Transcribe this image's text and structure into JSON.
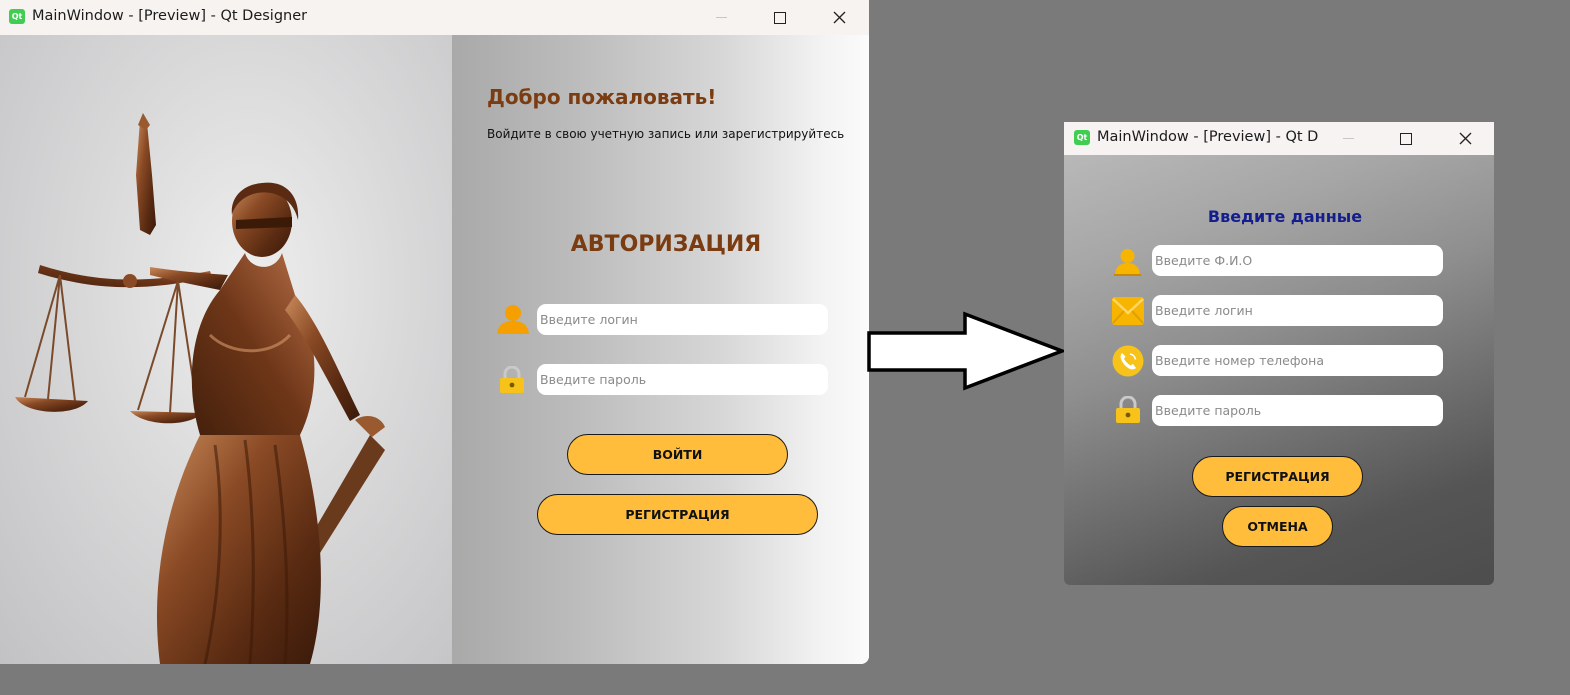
{
  "main_window": {
    "title": "MainWindow - [Preview] - Qt Designer",
    "logo_text": "Qt",
    "welcome_title": "Добро пожаловать!",
    "welcome_subtitle": "Войдите в свою учетную запись или зарегистрируйтесь",
    "auth_title": "АВТОРИЗАЦИЯ",
    "login_placeholder": "Введите логин",
    "password_placeholder": "Введите пароль",
    "login_button": "ВОЙТИ",
    "register_button": "РЕГИСТРАЦИЯ"
  },
  "register_window": {
    "title": "MainWindow - [Preview] - Qt D...",
    "logo_text": "Qt",
    "header": "Введите данные",
    "fio_placeholder": "Введите Ф.И.О",
    "login_placeholder": "Введите логин",
    "phone_placeholder": "Введите номер телефона",
    "password_placeholder": "Введите пароль",
    "register_button": "РЕГИСТРАЦИЯ",
    "cancel_button": "ОТМЕНА"
  },
  "colors": {
    "accent_button": "#ffbd3b",
    "brown_heading": "#7b3c12",
    "blue_heading": "#141e8c",
    "icon_orange": "#f5a000",
    "icon_yellow": "#f7c31a"
  },
  "icons": [
    "qt-logo-icon",
    "minimize-icon",
    "maximize-icon",
    "close-icon",
    "user-icon",
    "lock-icon",
    "person-icon",
    "mail-icon",
    "phone-icon",
    "arrow-icon"
  ]
}
